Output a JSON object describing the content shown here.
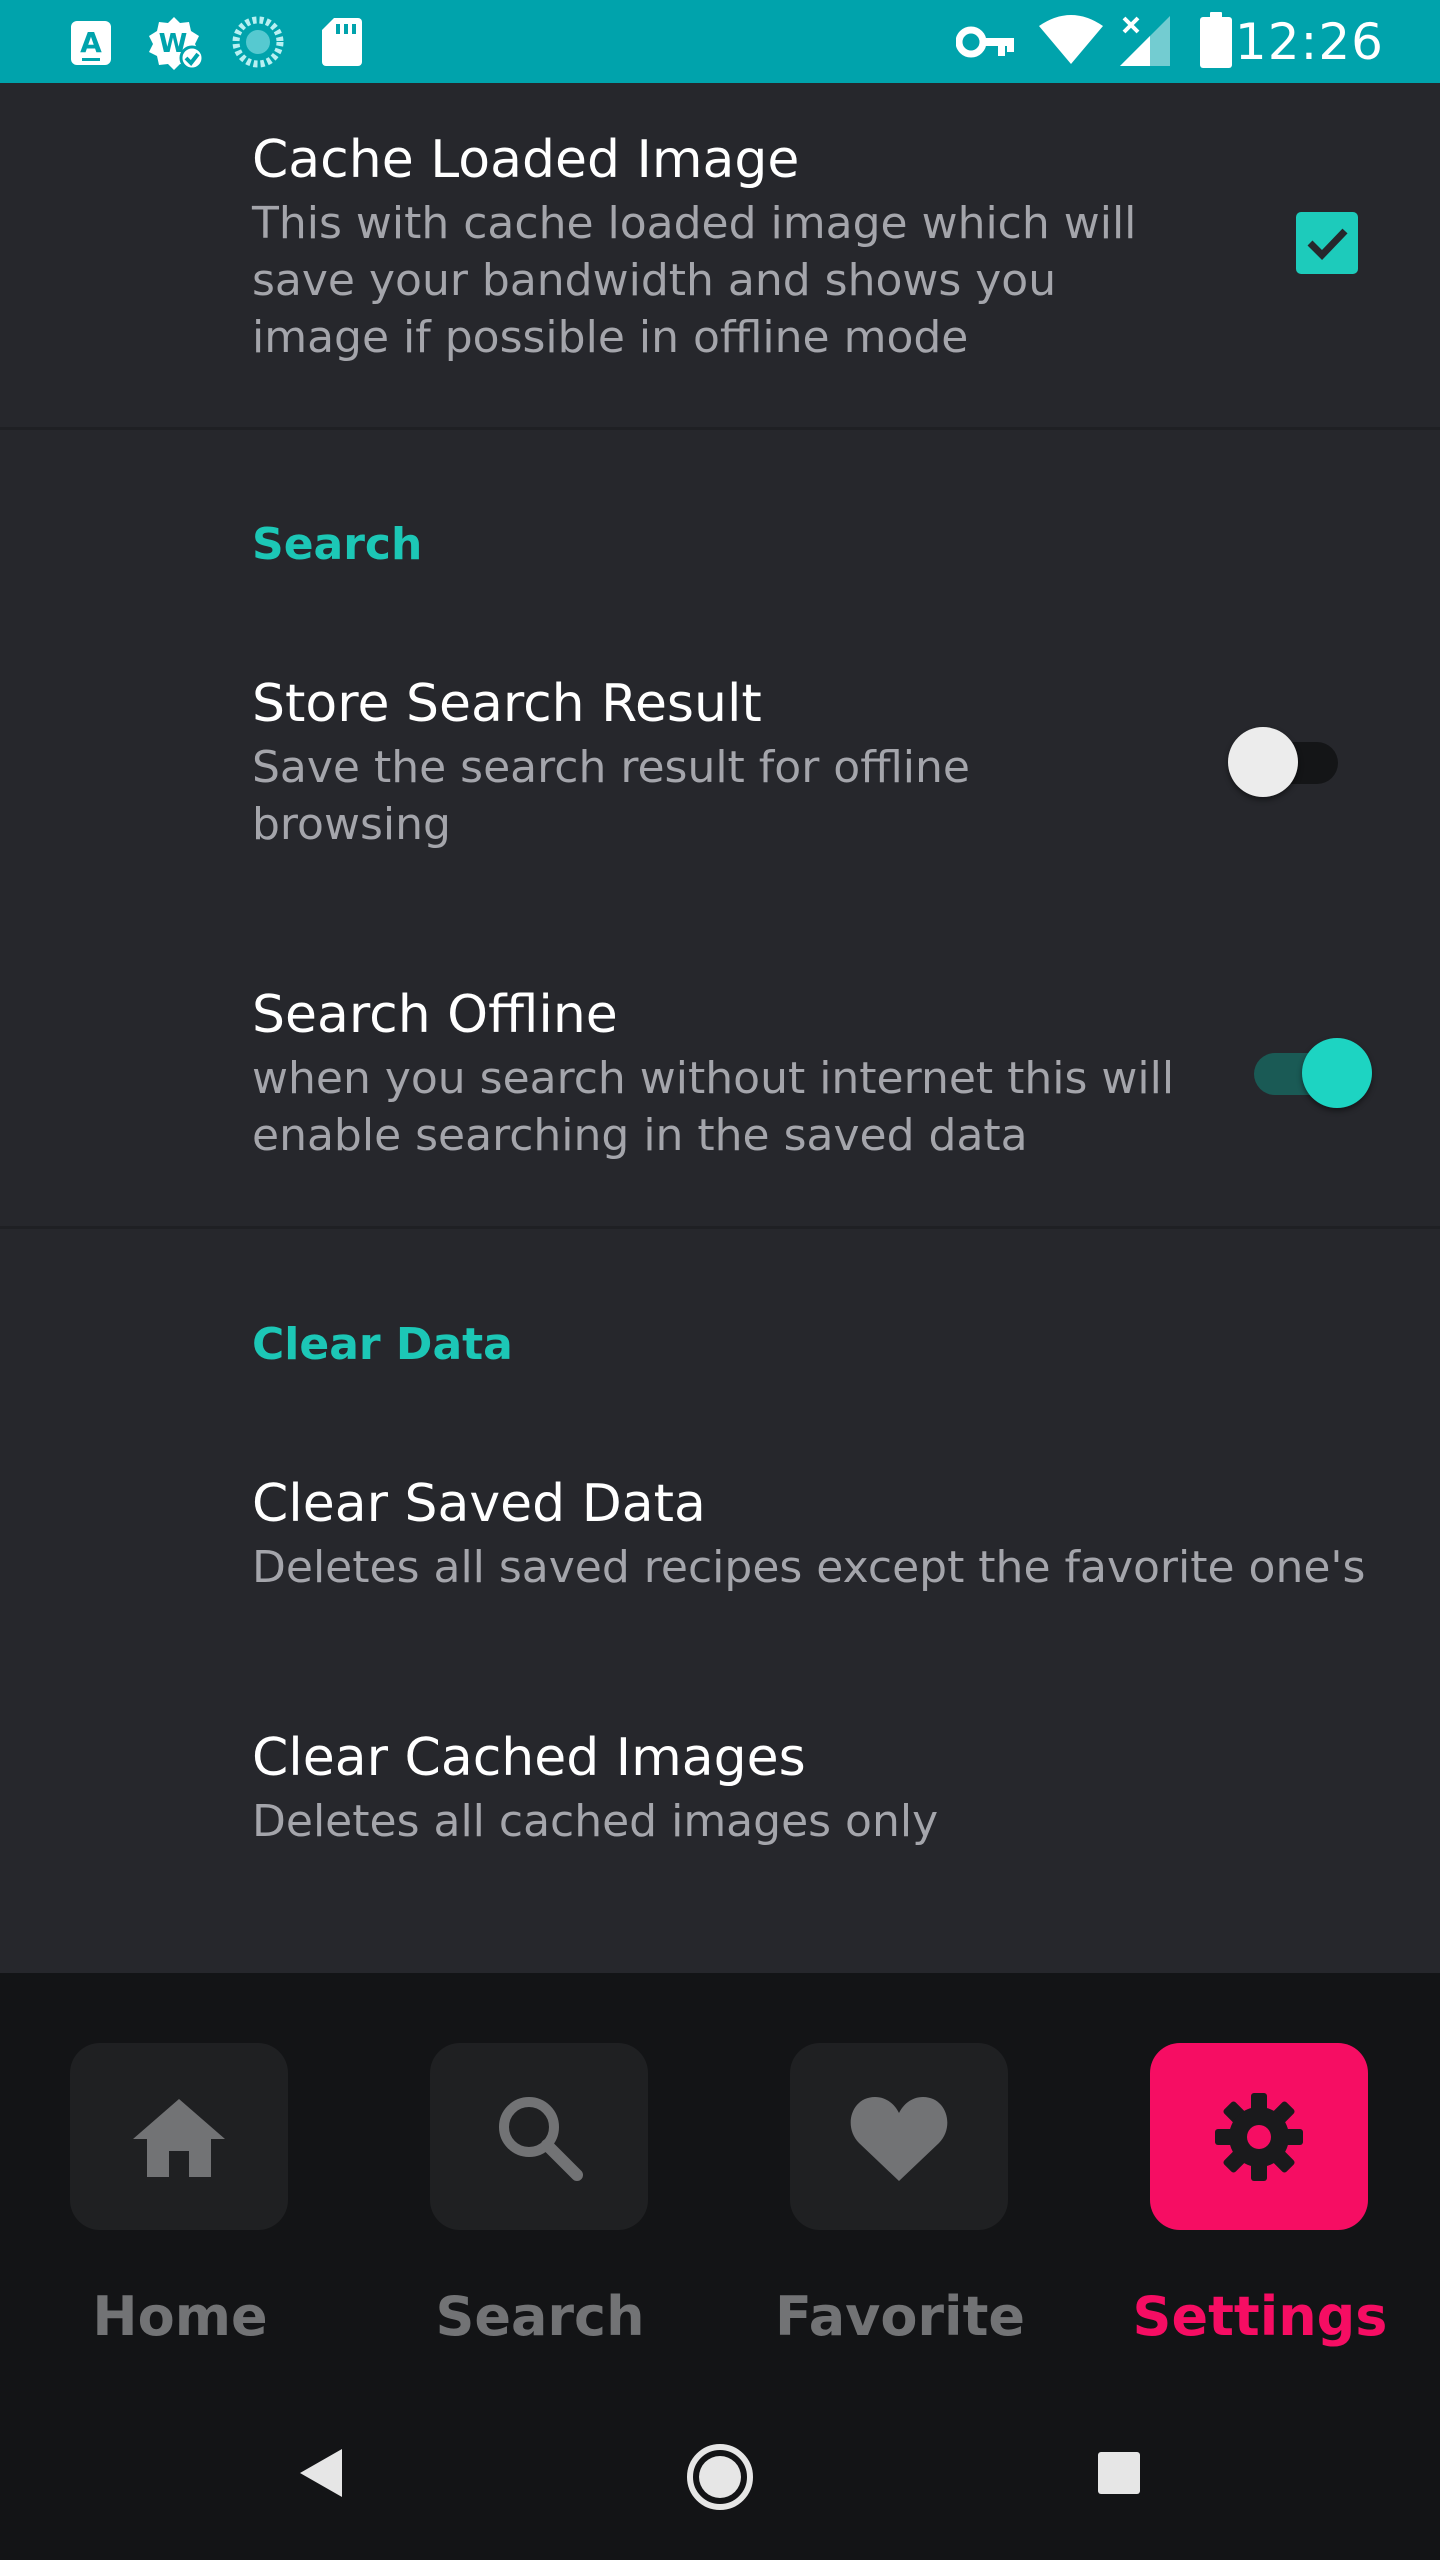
{
  "status_bar": {
    "time": "12:26",
    "left_icons": [
      "keyboard-a-icon",
      "w-badge-check-icon",
      "sync-spinner-icon",
      "sd-card-icon"
    ],
    "right_icons": [
      "vpn-key-icon",
      "wifi-icon",
      "no-signal-icon",
      "battery-icon"
    ]
  },
  "settings": {
    "cache_image": {
      "title": "Cache Loaded Image",
      "summary": "This with cache loaded image which will save your bandwidth and shows you image if possible in offline mode",
      "checked": true
    },
    "search_section": {
      "header": "Search",
      "store_result": {
        "title": "Store Search Result",
        "summary": "Save the search result for offline browsing",
        "enabled": false
      },
      "search_offline": {
        "title": "Search Offline",
        "summary": "when you search without internet this will enable searching in the saved data",
        "enabled": true
      }
    },
    "clear_section": {
      "header": "Clear Data",
      "clear_saved": {
        "title": "Clear Saved Data",
        "summary": "Deletes all saved recipes except the favorite one's"
      },
      "clear_cached": {
        "title": "Clear Cached Images",
        "summary": "Deletes all cached images only"
      }
    }
  },
  "bottom_nav": {
    "items": [
      {
        "label": "Home",
        "icon": "home-icon",
        "active": false
      },
      {
        "label": "Search",
        "icon": "search-icon",
        "active": false
      },
      {
        "label": "Favorite",
        "icon": "heart-icon",
        "active": false
      },
      {
        "label": "Settings",
        "icon": "gear-icon",
        "active": true
      }
    ]
  },
  "system_nav": [
    "back-icon",
    "home-circle-icon",
    "recents-icon"
  ],
  "colors": {
    "status_bar": "#00a3ac",
    "background": "#26272c",
    "accent_teal": "#1cc7b6",
    "active_pink": "#f60d63",
    "nav_background": "#131416"
  }
}
